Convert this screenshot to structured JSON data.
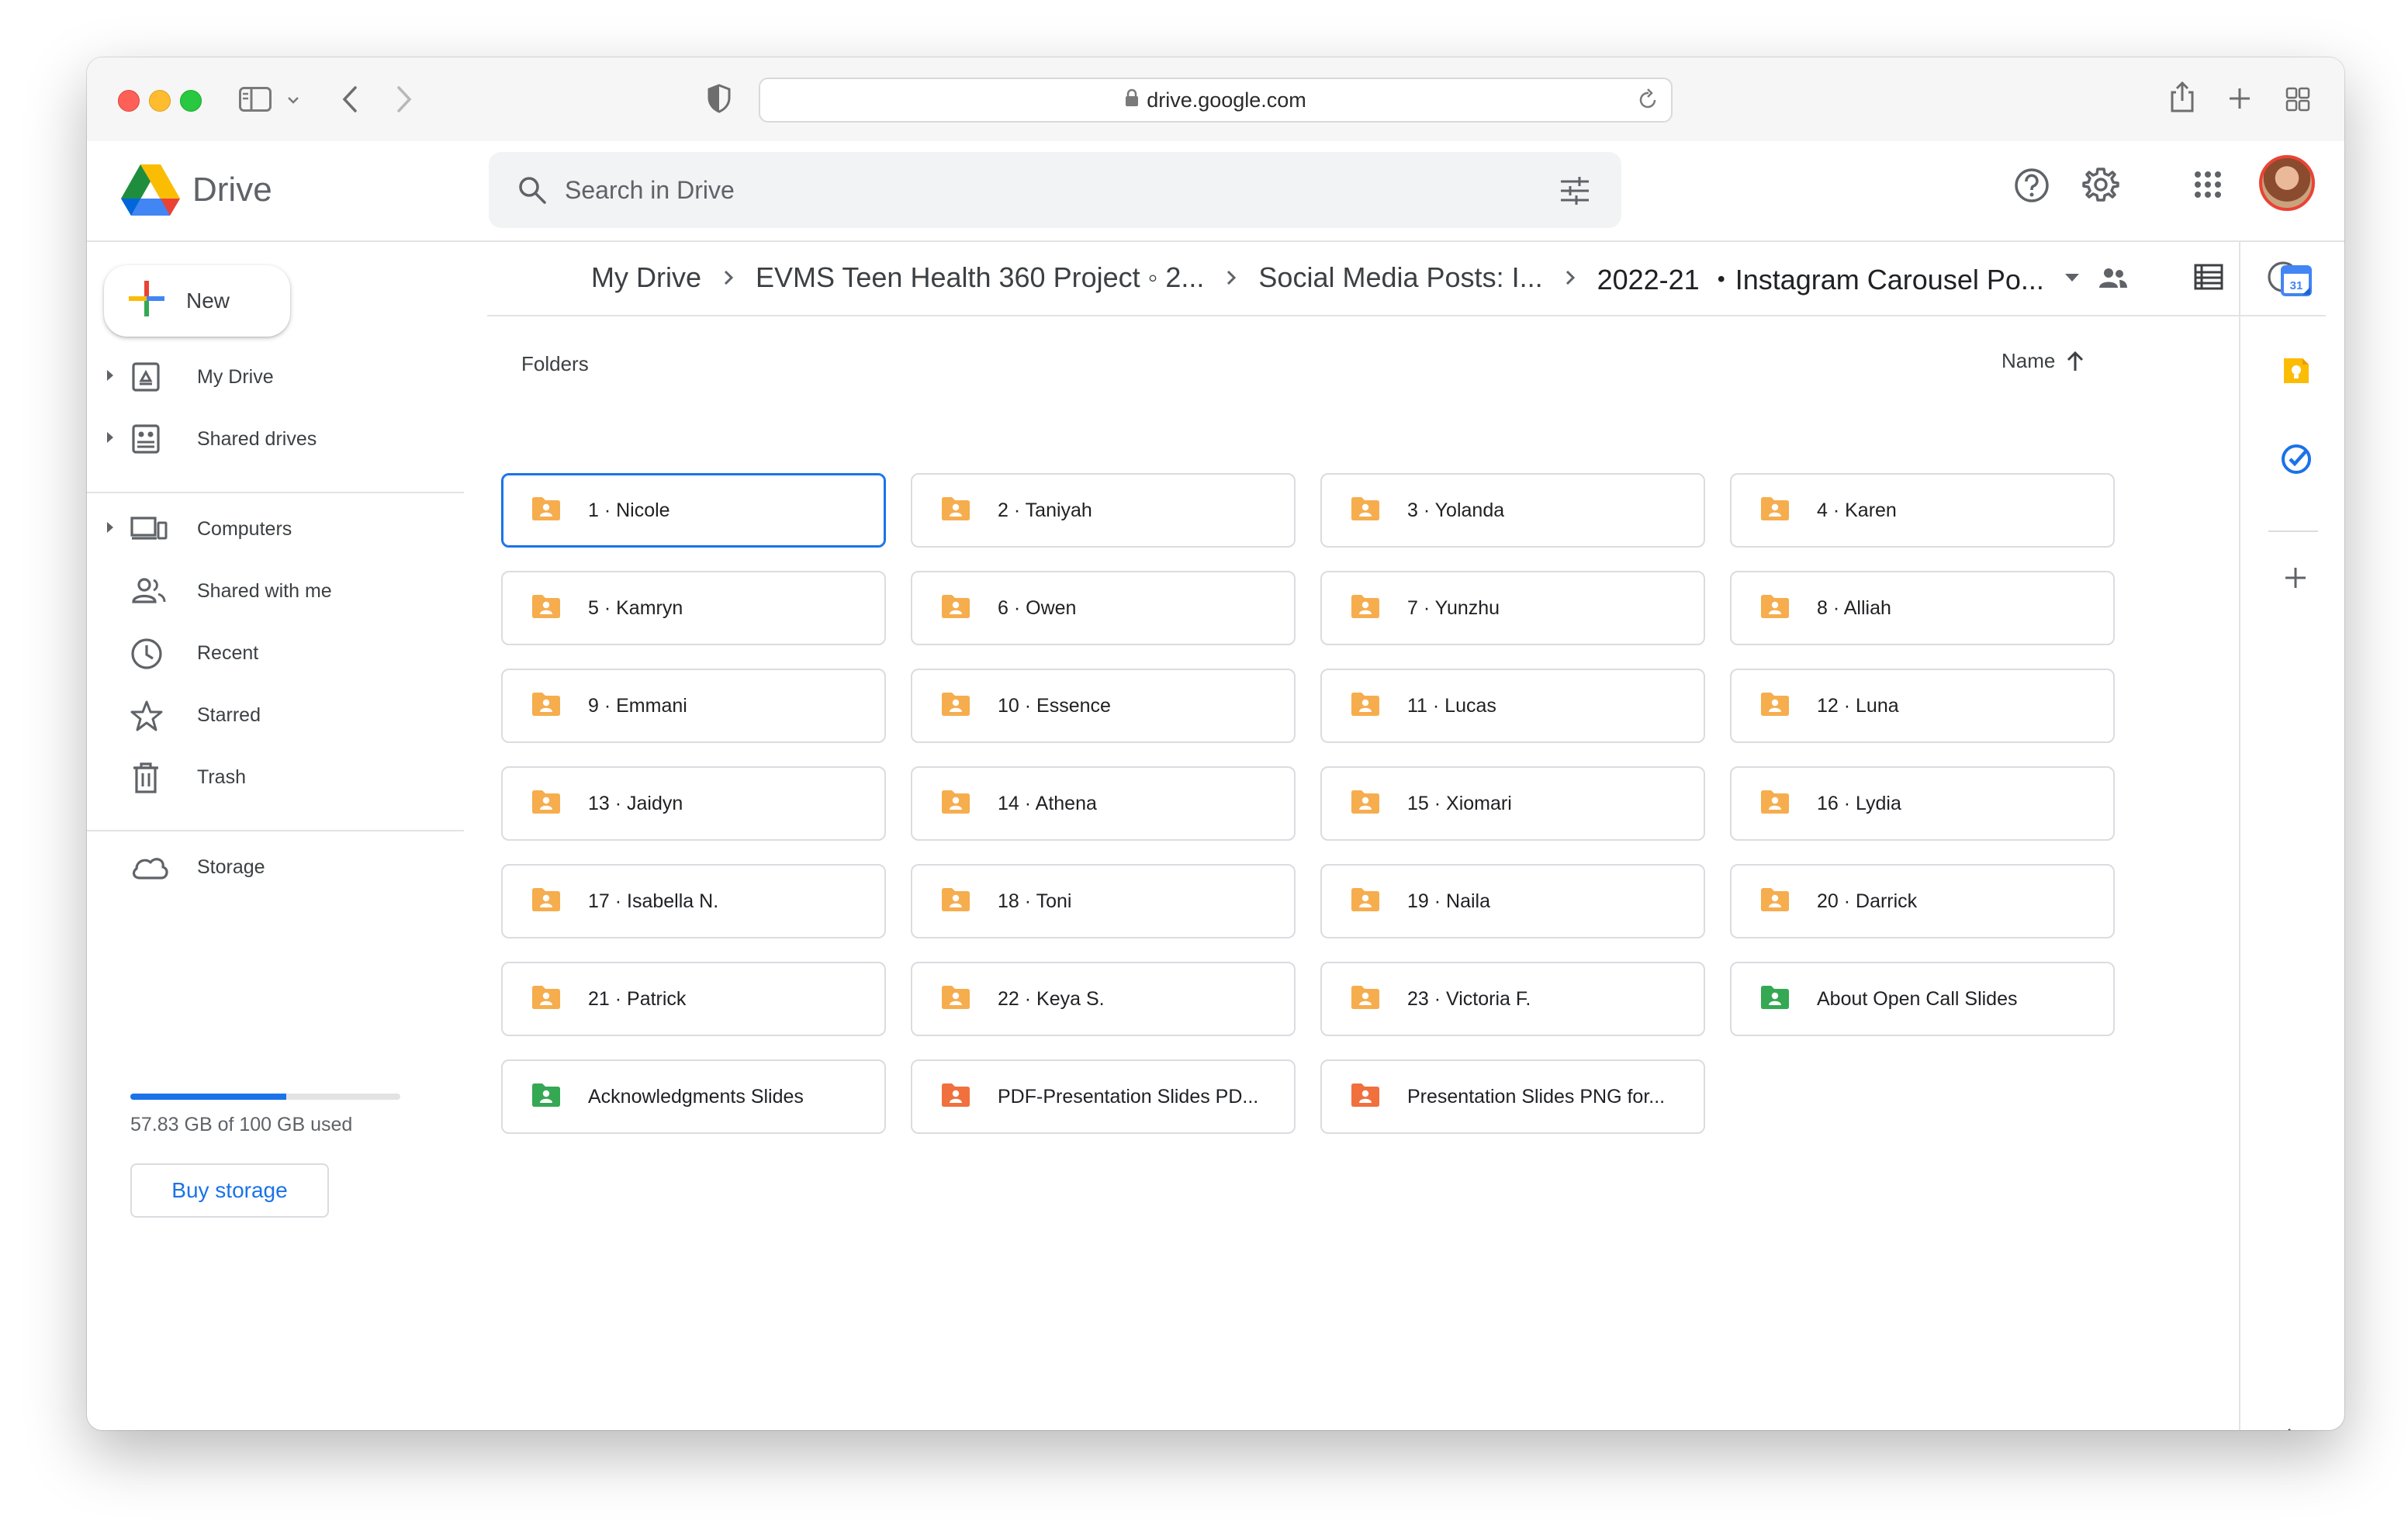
{
  "browser": {
    "url": "drive.google.com"
  },
  "header": {
    "app_name": "Drive",
    "search_placeholder": "Search in Drive"
  },
  "sidebar": {
    "new_label": "New",
    "items": [
      {
        "label": "My Drive"
      },
      {
        "label": "Shared drives"
      },
      {
        "label": "Computers"
      },
      {
        "label": "Shared with me"
      },
      {
        "label": "Recent"
      },
      {
        "label": "Starred"
      },
      {
        "label": "Trash"
      },
      {
        "label": "Storage"
      }
    ],
    "storage": {
      "used_text": "57.83 GB of 100 GB used",
      "used_fraction": 0.5783,
      "buy_label": "Buy storage"
    }
  },
  "breadcrumb": [
    {
      "label": "My Drive"
    },
    {
      "label": "EVMS Teen Health 360 Project ◦ 2..."
    },
    {
      "label": "Social Media Posts: I..."
    },
    {
      "label": "2022-21 ・Instagram Carousel Po..."
    }
  ],
  "content": {
    "section_label": "Folders",
    "sort_label": "Name",
    "folders": [
      {
        "name": "1 · Nicole",
        "color": "#f6ad4e",
        "selected": true
      },
      {
        "name": "2 · Taniyah",
        "color": "#f6ad4e"
      },
      {
        "name": "3 · Yolanda",
        "color": "#f6ad4e"
      },
      {
        "name": "4 · Karen",
        "color": "#f6ad4e"
      },
      {
        "name": "5 · Kamryn",
        "color": "#f6ad4e"
      },
      {
        "name": "6 · Owen",
        "color": "#f6ad4e"
      },
      {
        "name": "7 · Yunzhu",
        "color": "#f6ad4e"
      },
      {
        "name": "8 · Alliah",
        "color": "#f6ad4e"
      },
      {
        "name": "9 · Emmani",
        "color": "#f6ad4e"
      },
      {
        "name": "10 · Essence",
        "color": "#f6ad4e"
      },
      {
        "name": "11 · Lucas",
        "color": "#f6ad4e"
      },
      {
        "name": "12 · Luna",
        "color": "#f6ad4e"
      },
      {
        "name": "13 · Jaidyn",
        "color": "#f6ad4e"
      },
      {
        "name": "14 · Athena",
        "color": "#f6ad4e"
      },
      {
        "name": "15 · Xiomari",
        "color": "#f6ad4e"
      },
      {
        "name": "16 · Lydia",
        "color": "#f6ad4e"
      },
      {
        "name": "17 · Isabella N.",
        "color": "#f6ad4e"
      },
      {
        "name": "18 · Toni",
        "color": "#f6ad4e"
      },
      {
        "name": "19 · Naila",
        "color": "#f6ad4e"
      },
      {
        "name": "20 · Darrick",
        "color": "#f6ad4e"
      },
      {
        "name": "21 · Patrick",
        "color": "#f6ad4e"
      },
      {
        "name": "22 · Keya S.",
        "color": "#f6ad4e"
      },
      {
        "name": "23 · Victoria F.",
        "color": "#f6ad4e"
      },
      {
        "name": "About Open Call Slides",
        "color": "#34a853"
      },
      {
        "name": "Acknowledgments Slides",
        "color": "#34a853"
      },
      {
        "name": "PDF-Presentation Slides PD...",
        "color": "#f0703e"
      },
      {
        "name": "Presentation Slides PNG for...",
        "color": "#f0703e"
      }
    ]
  },
  "colors": {
    "accent": "#1a73e8",
    "folder_yellow": "#f6ad4e",
    "folder_green": "#34a853",
    "folder_orange": "#f0703e"
  }
}
